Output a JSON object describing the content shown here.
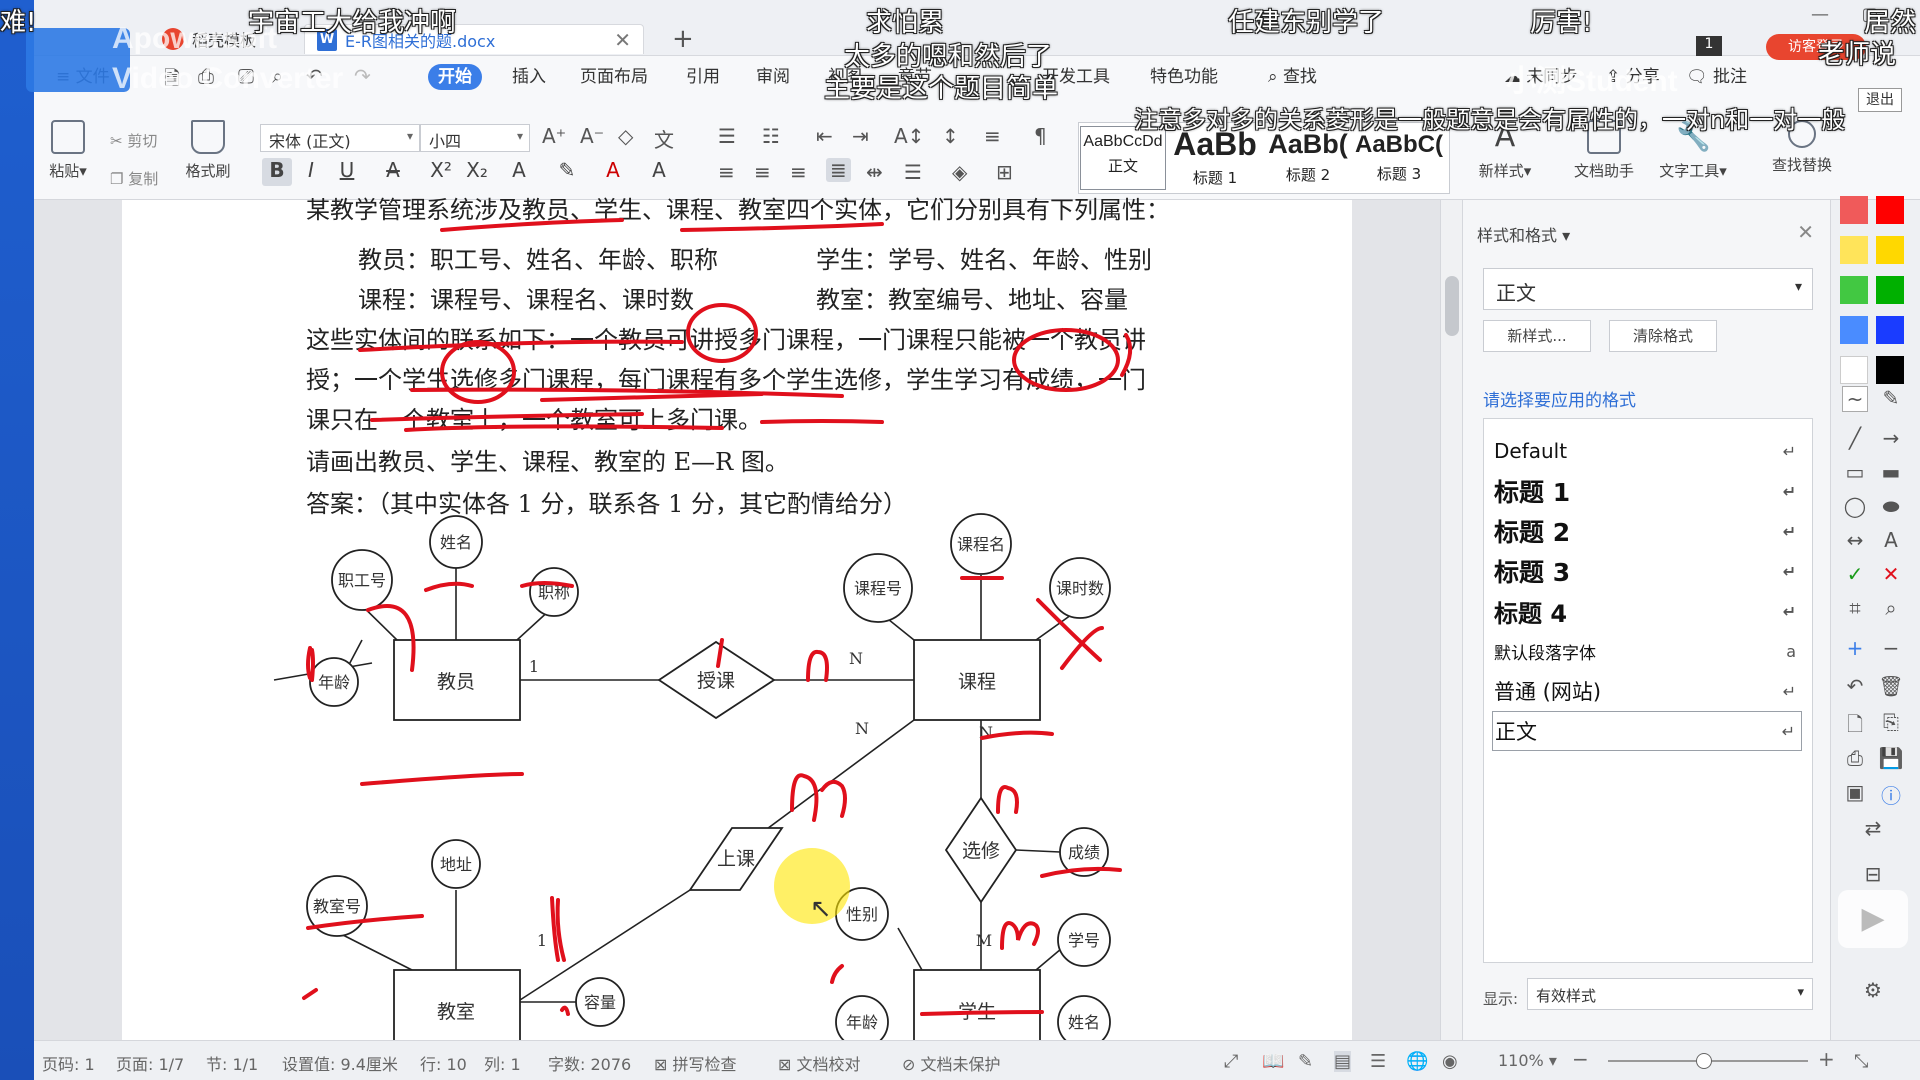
{
  "tabs": [
    {
      "label": "稻壳模板"
    },
    {
      "label": "E-R图相关的题.docx"
    }
  ],
  "menu": [
    "文件",
    "开始",
    "插入",
    "页面布局",
    "引用",
    "审阅",
    "视图",
    "章节",
    "开发工具",
    "特色功能",
    "查找"
  ],
  "menu_right": {
    "unsync": "未同步",
    "share": "分享",
    "comment": "批注"
  },
  "toolbar": {
    "paste": "粘贴",
    "cut": "剪切",
    "copy": "复制",
    "format_painter": "格式刷",
    "font_name": "宋体 (正文)",
    "font_size": "小四",
    "styles": [
      {
        "preview": "AaBbCcDd",
        "label": "正文"
      },
      {
        "preview": "AaBb",
        "label": "标题 1"
      },
      {
        "preview": "AaBb(",
        "label": "标题 2"
      },
      {
        "preview": "AaBbC(",
        "label": "标题 3"
      }
    ],
    "new_style": "新样式",
    "doc_helper": "文档助手",
    "text_tool": "文字工具",
    "find_replace": "查找替换",
    "exit": "退出"
  },
  "document": {
    "lines": [
      "某教学管理系统涉及教员、学生、课程、教室四个实体，它们分别具有下列属性：",
      "教员：职工号、姓名、年龄、职称",
      "学生：学号、姓名、年龄、性别",
      "课程：课程号、课程名、课时数",
      "教室：教室编号、地址、容量",
      "这些实体间的联系如下：一个教员可讲授多门课程，一门课程只能被一个教员讲",
      "授；一个学生选修多门课程，每门课程有多个学生选修，学生学习有成绩，一门",
      "课只在一个教室上，一个教室可上多门课。",
      "请画出教员、学生、课程、教室的 E—R 图。",
      "答案：（其中实体各 1 分，联系各 1 分，其它酌情给分）"
    ],
    "er": {
      "entities": [
        "教员",
        "课程",
        "教室",
        "学生"
      ],
      "relations": [
        "授课",
        "上课",
        "选修"
      ],
      "attributes": [
        "职工号",
        "姓名",
        "职称",
        "年龄",
        "课程号",
        "课程名",
        "课时数",
        "成绩",
        "地址",
        "教室号",
        "容量",
        "性别",
        "学号",
        "年龄",
        "姓名"
      ],
      "cardinalities": [
        "1",
        "N",
        "N",
        "N",
        "1",
        "M"
      ]
    }
  },
  "panel": {
    "title": "样式和格式",
    "current": "正文",
    "new_style_btn": "新样式...",
    "clear_btn": "清除格式",
    "hint": "请选择要应用的格式",
    "items": [
      "Default",
      "标题  1",
      "标题  2",
      "标题  3",
      "标题  4",
      "默认段落字体",
      "普通 (网站)",
      "正文"
    ],
    "show_label": "显示:",
    "show_value": "有效样式"
  },
  "status": {
    "page": "页码: 1",
    "pages": "页面: 1/7",
    "section": "节: 1/1",
    "setting": "设置值: 9.4厘米",
    "row": "行: 10",
    "col": "列: 1",
    "words": "字数: 2076",
    "spell": "拼写检查",
    "proof": "文档校对",
    "protect": "文档未保护",
    "zoom": "110%"
  },
  "overlays": {
    "danmaku": [
      "难!",
      "宇宙工大给我冲啊",
      "求怕累",
      "太多的嗯和然后了",
      "主要是这个题目简单",
      "任建东别学了",
      "厉害!",
      "居然",
      "老师说",
      "注意多对多的关系菱形是一般题意是会有属性的，一对n和一对一般"
    ],
    "watermark_top": "Apowersoft",
    "watermark_sub": "Video Converter",
    "watermark_right": "小测Student",
    "tip": "访客登录"
  },
  "colors": {
    "accent": "#3b7ee8",
    "annotation": "#e0101c",
    "swatches": [
      "#f05a5a",
      "#ff0000",
      "#ffe45a",
      "#ffd800",
      "#42c842",
      "#00b000",
      "#4a8cff",
      "#1a3cff",
      "#ffffff",
      "#000000"
    ]
  }
}
